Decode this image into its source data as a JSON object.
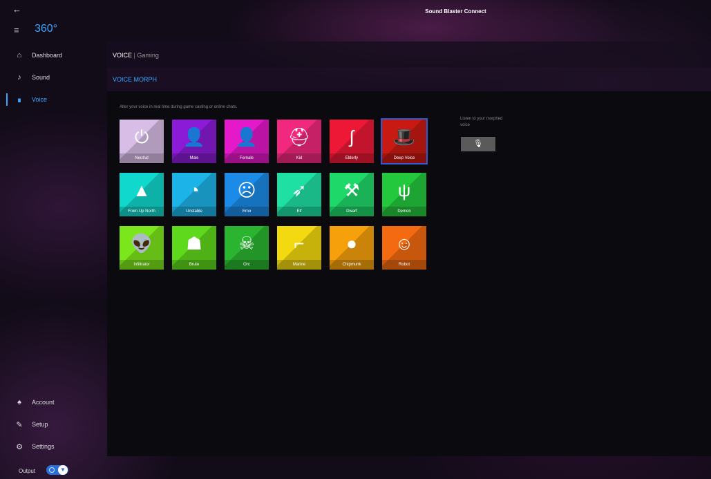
{
  "window": {
    "title": "Sound Blaster Connect",
    "back_glyph": "🡐"
  },
  "brand": {
    "label": "360°"
  },
  "sidebar": {
    "items": [
      {
        "label": "Dashboard",
        "icon": "home-icon"
      },
      {
        "label": "Sound",
        "icon": "music-note-icon"
      },
      {
        "label": "Voice",
        "icon": "voice-icon"
      }
    ],
    "bottom_items": [
      {
        "label": "Account",
        "icon": "account-icon"
      },
      {
        "label": "Setup",
        "icon": "setup-icon"
      },
      {
        "label": "Settings",
        "icon": "settings-icon"
      }
    ]
  },
  "breadcrumb": {
    "section": "VOICE",
    "separator": "|",
    "sub": "Gaming"
  },
  "panel": {
    "title": "VOICE MORPH",
    "description": "Alter your voice in real time during game casting or online chats.",
    "listen_text": "Listen to your morphed voice"
  },
  "tiles": [
    {
      "label": "Neutral",
      "color": "#d8bde6",
      "glyph": "⏻",
      "selected": false
    },
    {
      "label": "Male",
      "color": "#8b1bd6",
      "glyph": "👤",
      "selected": false
    },
    {
      "label": "Female",
      "color": "#e419c9",
      "glyph": "👤",
      "selected": false
    },
    {
      "label": "Kid",
      "color": "#f1287e",
      "glyph": "⛑",
      "selected": false
    },
    {
      "label": "Elderly",
      "color": "#ec1836",
      "glyph": "ʃ",
      "selected": false
    },
    {
      "label": "Deep Voice",
      "color": "#c81a12",
      "glyph": "🎩",
      "selected": true
    },
    {
      "label": "From Up North",
      "color": "#11d8cc",
      "glyph": "▲",
      "selected": false
    },
    {
      "label": "Unstable",
      "color": "#1cb3e8",
      "glyph": "◔",
      "selected": false
    },
    {
      "label": "Emo",
      "color": "#1c8be8",
      "glyph": "☹",
      "selected": false
    },
    {
      "label": "Elf",
      "color": "#1fe0a3",
      "glyph": "➶",
      "selected": false
    },
    {
      "label": "Dwarf",
      "color": "#1fd86a",
      "glyph": "⚒",
      "selected": false
    },
    {
      "label": "Demon",
      "color": "#24c83d",
      "glyph": "ψ",
      "selected": false
    },
    {
      "label": "Infiltrator",
      "color": "#7be61b",
      "glyph": "👽",
      "selected": false
    },
    {
      "label": "Brute",
      "color": "#5fd91c",
      "glyph": "☗",
      "selected": false
    },
    {
      "label": "Orc",
      "color": "#2bb42f",
      "glyph": "☠",
      "selected": false
    },
    {
      "label": "Marine",
      "color": "#f3d90f",
      "glyph": "⌐",
      "selected": false
    },
    {
      "label": "Chipmunk",
      "color": "#f6a10c",
      "glyph": "●",
      "selected": false
    },
    {
      "label": "Robot",
      "color": "#f36a10",
      "glyph": "☺",
      "selected": false
    }
  ],
  "mic_button": {
    "glyph": "🎙",
    "icon": "microphone-icon"
  },
  "status": {
    "output_label": "Output",
    "toggle_on": true
  }
}
